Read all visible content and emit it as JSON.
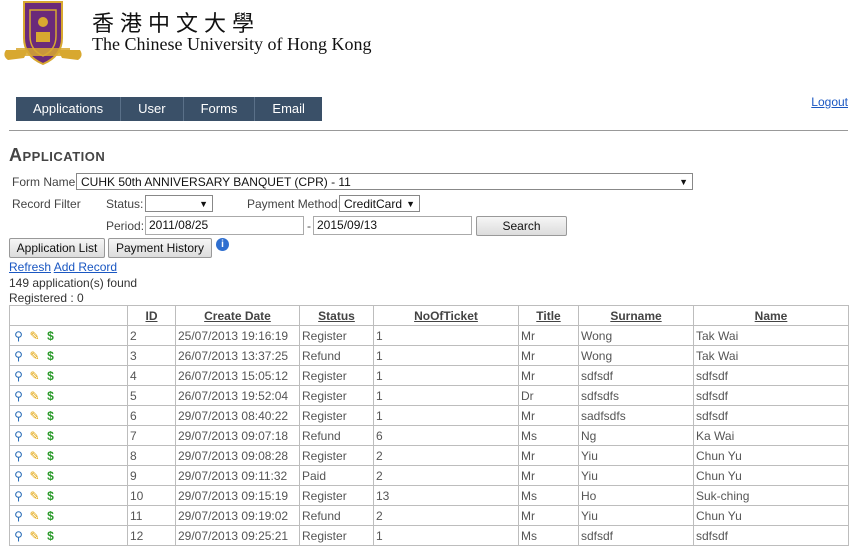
{
  "header": {
    "university_zh": "香港中文大學",
    "university_en": "The Chinese University of Hong Kong"
  },
  "nav": [
    "Applications",
    "User",
    "Forms",
    "Email"
  ],
  "logout": "Logout",
  "page_title": "Application",
  "filters": {
    "form_name_label": "Form Name",
    "form_name_value": "CUHK 50th ANNIVERSARY BANQUET (CPR) - 11",
    "record_filter_label": "Record Filter",
    "status_label": "Status:",
    "status_value": "",
    "payment_method_label": "Payment Method:",
    "payment_method_value": "CreditCard",
    "period_label": "Period:",
    "period_from": "2011/08/25",
    "period_sep": "-",
    "period_to": "2015/09/13",
    "search_button": "Search"
  },
  "buttons": {
    "application_list": "Application List",
    "payment_history": "Payment History"
  },
  "links": {
    "refresh": "Refresh",
    "add_record": "Add Record"
  },
  "summary": {
    "found": "149 application(s) found",
    "registered": "Registered : 0"
  },
  "table": {
    "columns": [
      "",
      "ID",
      "Create Date",
      "Status",
      "NoOfTicket",
      "Title",
      "Surname",
      "Name"
    ],
    "rows": [
      [
        "2",
        "25/07/2013 19:16:19",
        "Register",
        "1",
        "Mr",
        "Wong",
        "Tak Wai"
      ],
      [
        "3",
        "26/07/2013 13:37:25",
        "Refund",
        "1",
        "Mr",
        "Wong",
        "Tak Wai"
      ],
      [
        "4",
        "26/07/2013 15:05:12",
        "Register",
        "1",
        "Mr",
        "sdfsdf",
        "sdfsdf"
      ],
      [
        "5",
        "26/07/2013 19:52:04",
        "Register",
        "1",
        "Dr",
        "sdfsdfs",
        "sdfsdf"
      ],
      [
        "6",
        "29/07/2013 08:40:22",
        "Register",
        "1",
        "Mr",
        "sadfsdfs",
        "sdfsdf"
      ],
      [
        "7",
        "29/07/2013 09:07:18",
        "Refund",
        "6",
        "Ms",
        "Ng",
        "Ka Wai"
      ],
      [
        "8",
        "29/07/2013 09:08:28",
        "Register",
        "2",
        "Mr",
        "Yiu",
        "Chun Yu"
      ],
      [
        "9",
        "29/07/2013 09:11:32",
        "Paid",
        "2",
        "Mr",
        "Yiu",
        "Chun Yu"
      ],
      [
        "10",
        "29/07/2013 09:15:19",
        "Register",
        "13",
        "Ms",
        "Ho",
        "Suk-ching"
      ],
      [
        "11",
        "29/07/2013 09:19:02",
        "Refund",
        "2",
        "Mr",
        "Yiu",
        "Chun Yu"
      ],
      [
        "12",
        "29/07/2013 09:25:21",
        "Register",
        "1",
        "Ms",
        "sdfsdf",
        "sdfsdf"
      ]
    ]
  },
  "icons": {
    "view": "magnifier-icon",
    "edit": "pencil-icon",
    "payment": "dollar-icon"
  },
  "colors": {
    "nav_bg": "#3a5068",
    "link": "#1a57c2",
    "logo_purple": "#6b2a7a",
    "logo_gold": "#d8a830"
  }
}
